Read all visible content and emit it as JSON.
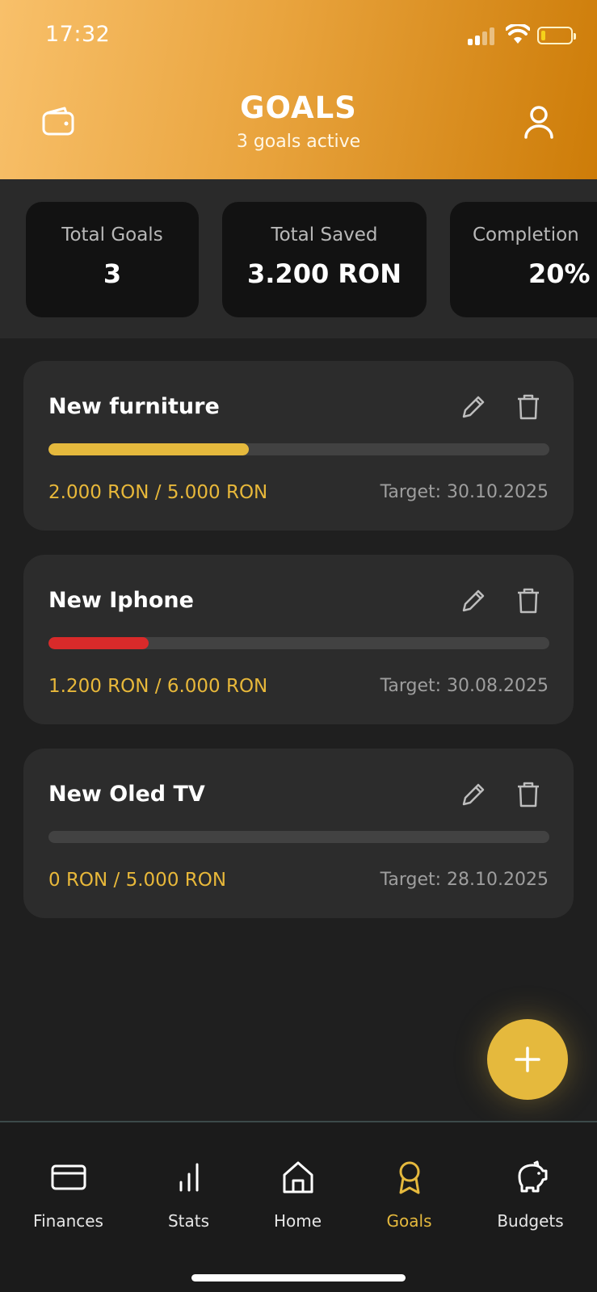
{
  "status_bar": {
    "time": "17:32"
  },
  "header": {
    "title": "GOALS",
    "subtitle": "3 goals active",
    "left_icon": "wallet-icon",
    "right_icon": "user-icon"
  },
  "stats": [
    {
      "label": "Total Goals",
      "value": "3"
    },
    {
      "label": "Total Saved",
      "value": "3.200 RON"
    },
    {
      "label": "Completion",
      "value": "20%"
    }
  ],
  "goals": [
    {
      "name": "New furniture",
      "amount": "2.000 RON / 5.000 RON",
      "target": "Target: 30.10.2025",
      "progress": 0.4,
      "color": "#e5b93d"
    },
    {
      "name": "New Iphone",
      "amount": "1.200 RON / 6.000 RON",
      "target": "Target: 30.08.2025",
      "progress": 0.2,
      "color": "#d92a2a"
    },
    {
      "name": "New Oled TV",
      "amount": "0 RON / 5.000 RON",
      "target": "Target: 28.10.2025",
      "progress": 0,
      "color": "#e5b93d"
    }
  ],
  "fab": {
    "icon": "plus-icon"
  },
  "nav": {
    "items": [
      {
        "label": "Finances",
        "icon": "card-icon"
      },
      {
        "label": "Stats",
        "icon": "bar-chart-icon"
      },
      {
        "label": "Home",
        "icon": "home-icon"
      },
      {
        "label": "Goals",
        "icon": "award-icon",
        "active": true
      },
      {
        "label": "Budgets",
        "icon": "piggy-bank-icon"
      }
    ]
  },
  "colors": {
    "accent": "#e5b93d",
    "header_gradient_start": "#f8c06a",
    "header_gradient_end": "#cd7c08",
    "background": "#1f1f1f",
    "card": "#2c2c2c",
    "danger": "#d92a2a"
  }
}
